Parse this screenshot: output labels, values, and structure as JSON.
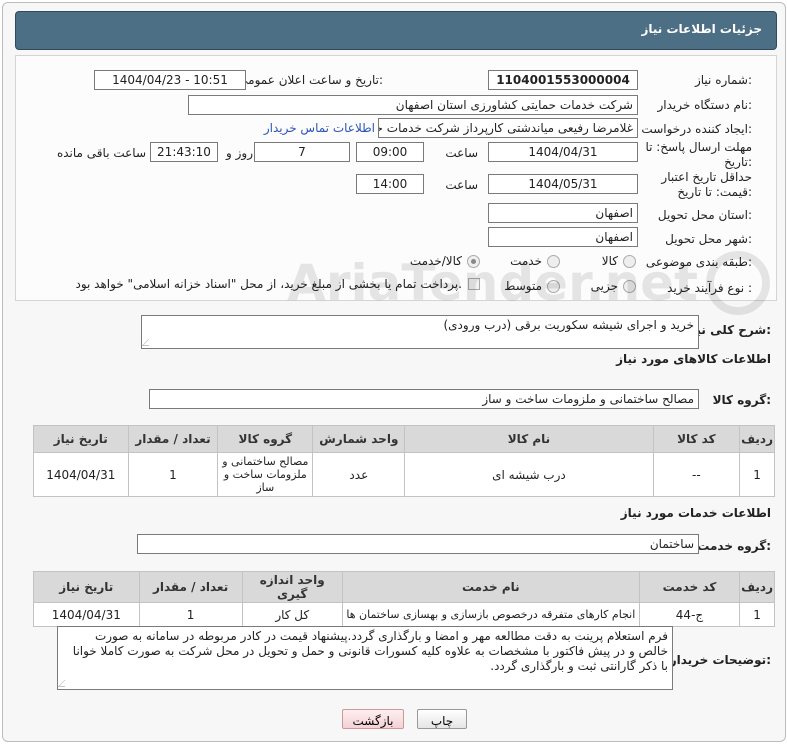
{
  "header": {
    "title": "جزئیات اطلاعات نیاز"
  },
  "form": {
    "need_number": {
      "label": "شماره نیاز:",
      "value": "1104001553000004"
    },
    "announce": {
      "label": "تاریخ و ساعت اعلان عمومی:",
      "value": "1404/04/23 - 10:51"
    },
    "buyer_org": {
      "label": "نام دستگاه خریدار:",
      "value": "شرکت خدمات حمایتی کشاورزی استان اصفهان"
    },
    "creator": {
      "label": "ایجاد کننده درخواست:",
      "value": "غلامرضا  رفیعی میاندشتی کارپرداز شرکت خدمات حمایتی کشاورزی استان اصفهان",
      "contact_link": "اطلاعات تماس خریدار"
    },
    "reply_deadline": {
      "label": "مهلت ارسال پاسخ: تا تاریخ:",
      "date": "1404/04/31",
      "time_label": "ساعت",
      "time": "09:00",
      "days": "7",
      "days_label": "روز و",
      "remaining": "21:43:10",
      "remaining_label": "ساعت باقی مانده"
    },
    "price_deadline": {
      "label": "حداقل تاریخ اعتبار قیمت: تا تاریخ:",
      "date": "1404/05/31",
      "time_label": "ساعت",
      "time": "14:00"
    },
    "delivery_province": {
      "label": "استان محل تحویل:",
      "value": "اصفهان"
    },
    "delivery_city": {
      "label": "شهر محل تحویل:",
      "value": "اصفهان"
    },
    "category": {
      "label": "طبقه بندی موضوعی:",
      "options": [
        "کالا",
        "خدمت",
        "کالا/خدمت"
      ],
      "selected": "کالا/خدمت"
    },
    "process": {
      "label": "نوع فرآیند خرید :",
      "options": [
        "جزیی",
        "متوسط"
      ],
      "payment_note": "پرداخت تمام یا بخشی از مبلغ خرید، از محل \"اسناد خزانه اسلامی\" خواهد بود."
    }
  },
  "description": {
    "label": "شرح کلی نیاز:",
    "value": "خرید و اجرای شیشه سکوریت برقی (درب ورودی)"
  },
  "goods": {
    "section_title": "اطلاعات کالاهای مورد نیاز",
    "group_label": "گروه کالا:",
    "group_value": "مصالح ساختمانی و ملزومات ساخت و ساز",
    "columns": [
      "ردیف",
      "کد کالا",
      "نام کالا",
      "واحد شمارش",
      "گروه کالا",
      "تعداد / مقدار",
      "تاریخ نیاز"
    ],
    "rows": [
      {
        "row": "1",
        "code": "--",
        "name": "درب شیشه ای",
        "unit": "عدد",
        "group": "مصالح ساختمانی و ملزومات ساخت و ساز",
        "qty": "1",
        "date": "1404/04/31"
      }
    ]
  },
  "services": {
    "section_title": "اطلاعات خدمات مورد نیاز",
    "group_label": "گروه خدمت:",
    "group_value": "ساختمان",
    "columns": [
      "ردیف",
      "کد خدمت",
      "نام خدمت",
      "واحد اندازه گیری",
      "تعداد / مقدار",
      "تاریخ نیاز"
    ],
    "rows": [
      {
        "row": "1",
        "code": "ج-44",
        "name": "انجام کارهای متفرقه درخصوص بازسازی و بهسازی ساختمان ها",
        "unit": "کل کار",
        "qty": "1",
        "date": "1404/04/31"
      }
    ]
  },
  "buyer_notes": {
    "label": "توضیحات خریدار:",
    "value": "فرم استعلام پرینت به دقت مطالعه مهر و امضا و بارگذاری گردد.پیشنهاد قیمت در کادر مربوطه در سامانه به صورت خالص و در پیش فاکتور با مشخصات به علاوه کلیه کسورات قانونی و حمل و تحویل در محل شرکت به صورت کاملا خوانا با ذکر گارانتی ثبت و بارگذاری گردد."
  },
  "buttons": {
    "print": "چاپ",
    "back": "بازگشت"
  },
  "watermark": "AriaTender.net",
  "colors": {
    "header": "#4d6f86",
    "link": "#2b55b5"
  }
}
